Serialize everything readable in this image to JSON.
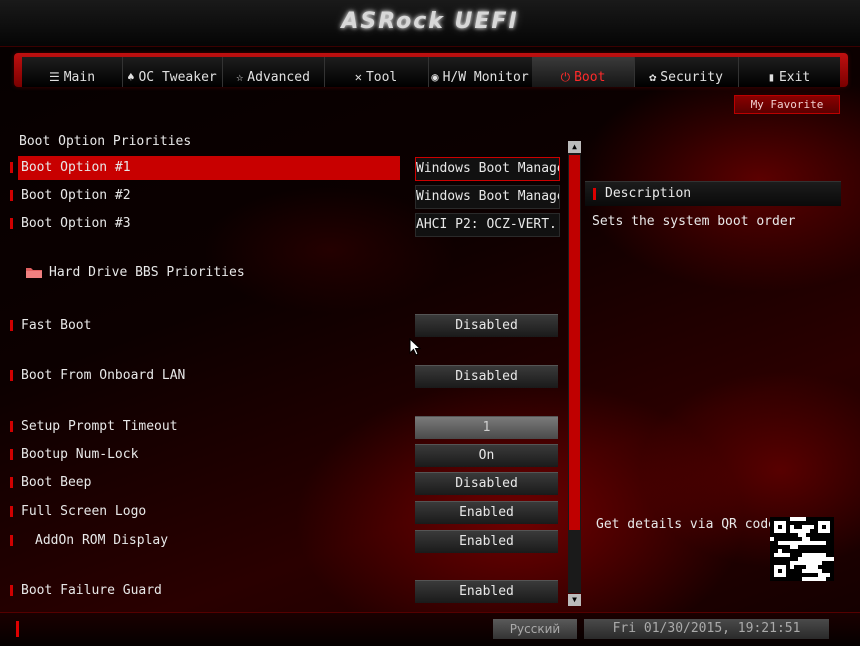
{
  "app": {
    "logo": "ASRock UEFI"
  },
  "nav": {
    "tabs": [
      {
        "icon": "☰",
        "label": "Main"
      },
      {
        "icon": "♠",
        "label": "OC Tweaker"
      },
      {
        "icon": "☆",
        "label": "Advanced"
      },
      {
        "icon": "✕",
        "label": "Tool"
      },
      {
        "icon": "◉",
        "label": "H/W Monitor"
      },
      {
        "icon": "⏻",
        "label": "Boot"
      },
      {
        "icon": "✿",
        "label": "Security"
      },
      {
        "icon": "▮",
        "label": "Exit"
      }
    ],
    "active": "Boot",
    "favorite": "My Favorite"
  },
  "content": {
    "section_title": "Boot Option Priorities",
    "rows": [
      {
        "label": "Boot Option #1",
        "value": "Windows Boot Manager"
      },
      {
        "label": "Boot Option #2",
        "value": "Windows Boot Manager"
      },
      {
        "label": "Boot Option #3",
        "value": "AHCI P2: OCZ-VERT..."
      },
      {
        "label": "Hard Drive BBS Priorities"
      },
      {
        "label": "Fast Boot",
        "value": "Disabled"
      },
      {
        "label": "Boot From Onboard LAN",
        "value": "Disabled"
      },
      {
        "label": "Setup Prompt Timeout",
        "value": "1"
      },
      {
        "label": "Bootup Num-Lock",
        "value": "On"
      },
      {
        "label": "Boot Beep",
        "value": "Disabled"
      },
      {
        "label": "Full Screen Logo",
        "value": "Enabled"
      },
      {
        "label": "AddOn ROM Display",
        "value": "Enabled"
      },
      {
        "label": "Boot Failure Guard",
        "value": "Enabled"
      }
    ]
  },
  "description": {
    "title": "Description",
    "text": "Sets the system boot order",
    "qr_label": "Get details via QR code"
  },
  "footer": {
    "language": "Русский",
    "datetime": "Fri 01/30/2015, 19:21:51"
  },
  "colors": {
    "accent": "#c80000",
    "text": "#e8e8e8",
    "panel": "#1a1a1a"
  }
}
